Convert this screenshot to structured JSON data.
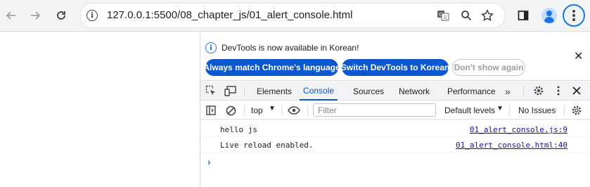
{
  "browser": {
    "url": "127.0.0.1:5500/08_chapter_js/01_alert_console.html",
    "icons": {
      "back": "arrow-left-icon",
      "forward": "arrow-right-icon",
      "reload": "reload-icon",
      "site_info": "info-icon",
      "translate": "translate-icon",
      "zoom": "zoom-icon",
      "bookmark": "star-icon",
      "side_panel": "side-panel-icon",
      "profile": "profile-icon",
      "menu": "kebab-menu-icon"
    },
    "accent_color": "#1a73e8"
  },
  "devtools": {
    "infobar": {
      "message": "DevTools is now available in Korean!",
      "buttons": [
        "Always match Chrome's language",
        "Switch DevTools to Korean",
        "Don't show again"
      ],
      "close": "✕"
    },
    "tabs": [
      "Elements",
      "Console",
      "Sources",
      "Network",
      "Performance"
    ],
    "active_tab": "Console",
    "more_tabs": "»",
    "toolbar": {
      "context": "top",
      "filter_placeholder": "Filter",
      "levels": "Default levels",
      "issues": "No Issues"
    },
    "console_messages": [
      {
        "text": "hello js",
        "source": "01_alert_console.js:9"
      },
      {
        "text": "Live reload enabled.",
        "source": "01_alert_console.html:40"
      }
    ],
    "prompt": "›"
  }
}
